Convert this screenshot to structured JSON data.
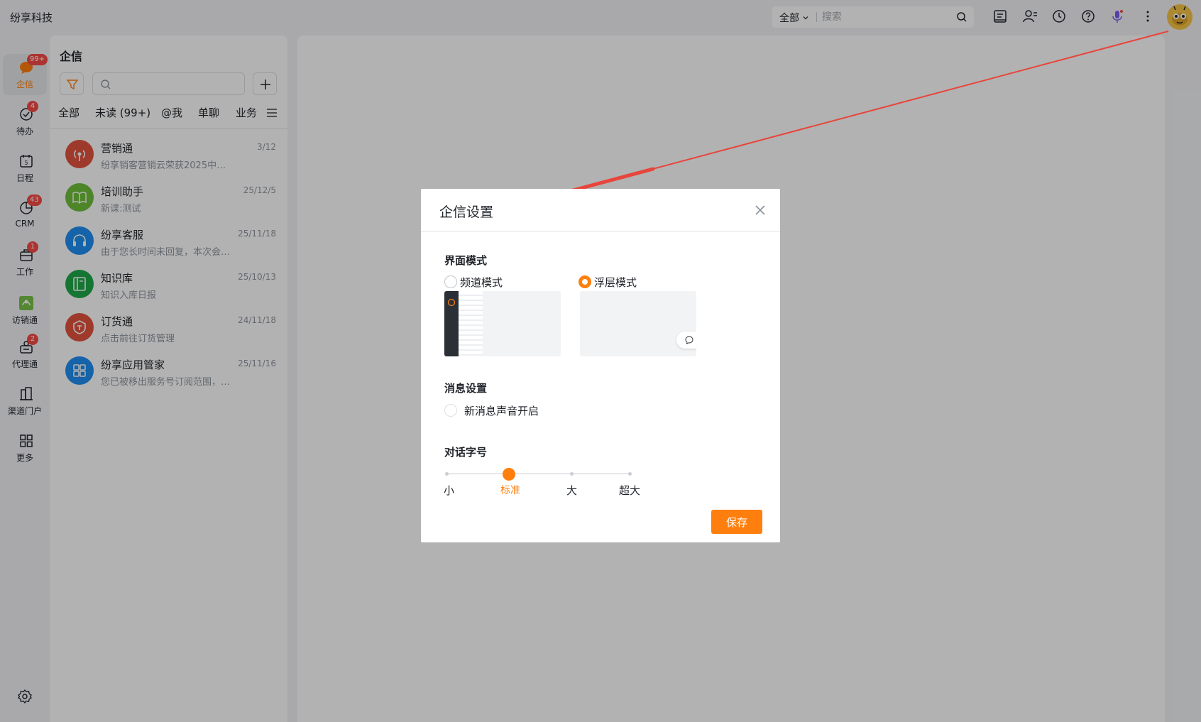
{
  "app": {
    "brand": "纷享科技"
  },
  "topbar": {
    "search_scope": "全部",
    "search_placeholder": "搜索"
  },
  "nav": {
    "items": [
      {
        "label": "企信",
        "badge": "99+",
        "icon": "chat-bubble-icon",
        "active": true
      },
      {
        "label": "待办",
        "badge": "4",
        "icon": "check-circle-icon"
      },
      {
        "label": "日程",
        "badge": "",
        "icon": "calendar-icon"
      },
      {
        "label": "CRM",
        "badge": "43",
        "icon": "pie-chart-icon"
      },
      {
        "label": "工作",
        "badge": "1",
        "icon": "briefcase-icon"
      },
      {
        "label": "访销通",
        "badge": "",
        "icon": "visit-sales-icon"
      },
      {
        "label": "代理通",
        "badge": "2",
        "icon": "agent-icon"
      },
      {
        "label": "渠道门户",
        "badge": "",
        "icon": "building-icon"
      },
      {
        "label": "更多",
        "badge": "",
        "icon": "grid-icon"
      }
    ]
  },
  "conversations_panel": {
    "title": "企信",
    "tabs": [
      "全部",
      "未读 (99+)",
      "@我",
      "单聊",
      "业务"
    ],
    "items": [
      {
        "name": "营销通",
        "time": "3/12",
        "preview": "纷享销客营销云荣获2025中…",
        "color": "#e2533f",
        "icon": "broadcast-icon"
      },
      {
        "name": "培训助手",
        "time": "25/12/5",
        "preview": "新课:测试",
        "color": "#6fbf3a",
        "icon": "book-icon"
      },
      {
        "name": "纷享客服",
        "time": "25/11/18",
        "preview": "由于您长时间未回复，本次会…",
        "color": "#1f8ef1",
        "icon": "headset-icon"
      },
      {
        "name": "知识库",
        "time": "25/10/13",
        "preview": "知识入库日报",
        "color": "#1faa4a",
        "icon": "knowledge-book-icon"
      },
      {
        "name": "订货通",
        "time": "24/11/18",
        "preview": "点击前往订货管理",
        "color": "#e2533f",
        "icon": "order-shield-icon"
      },
      {
        "name": "纷享应用管家",
        "time": "25/11/16",
        "preview": "您已被移出服务号订阅范围，…",
        "color": "#1f8ef1",
        "icon": "apps-grid-icon"
      }
    ]
  },
  "dialog": {
    "title": "企信设置",
    "ui_mode": {
      "section_title": "界面模式",
      "options": [
        {
          "label": "频道模式",
          "checked": false
        },
        {
          "label": "浮层模式",
          "checked": true
        }
      ]
    },
    "message": {
      "section_title": "消息设置",
      "sound_label": "新消息声音开启",
      "sound_enabled": false
    },
    "font_size": {
      "section_title": "对话字号",
      "options": [
        "小",
        "标准",
        "大",
        "超大"
      ],
      "selected": "标准"
    },
    "save_label": "保存"
  },
  "colors": {
    "accent": "#ff7f0e",
    "badge": "#f54a45",
    "annotation_arrow": "#e8453c"
  }
}
